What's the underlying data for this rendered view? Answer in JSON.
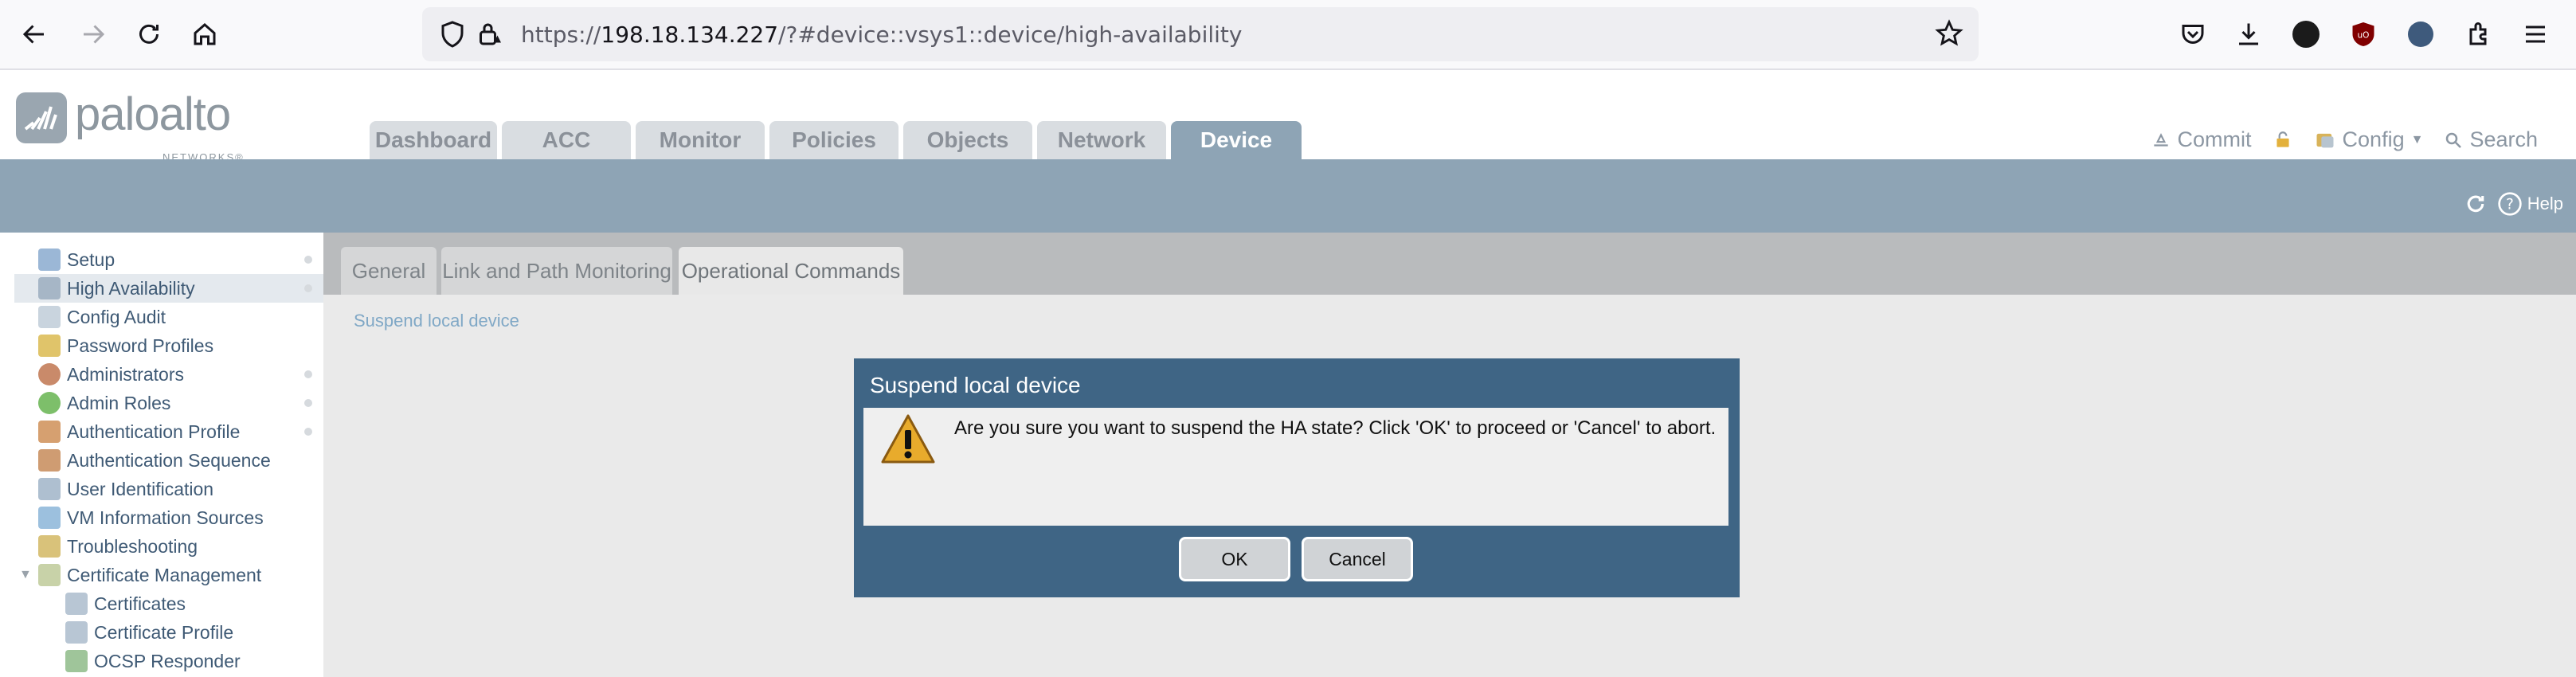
{
  "browser": {
    "url_prefix": "https://",
    "url_host": "198.18.134.227",
    "url_path": "/?#device::vsys1::device/high-availability"
  },
  "logo": {
    "name": "paloalto",
    "sub": "NETWORKS®"
  },
  "main_tabs": [
    {
      "label": "Dashboard"
    },
    {
      "label": "ACC"
    },
    {
      "label": "Monitor"
    },
    {
      "label": "Policies"
    },
    {
      "label": "Objects"
    },
    {
      "label": "Network"
    },
    {
      "label": "Device"
    }
  ],
  "header_actions": {
    "commit": "Commit",
    "config": "Config",
    "search": "Search",
    "help": "Help"
  },
  "sidebar": {
    "items": [
      {
        "label": "Setup"
      },
      {
        "label": "High Availability"
      },
      {
        "label": "Config Audit"
      },
      {
        "label": "Password Profiles"
      },
      {
        "label": "Administrators"
      },
      {
        "label": "Admin Roles"
      },
      {
        "label": "Authentication Profile"
      },
      {
        "label": "Authentication Sequence"
      },
      {
        "label": "User Identification"
      },
      {
        "label": "VM Information Sources"
      },
      {
        "label": "Troubleshooting"
      },
      {
        "label": "Certificate Management"
      },
      {
        "label": "Certificates"
      },
      {
        "label": "Certificate Profile"
      },
      {
        "label": "OCSP Responder"
      }
    ]
  },
  "sub_tabs": [
    {
      "label": "General"
    },
    {
      "label": "Link and Path Monitoring"
    },
    {
      "label": "Operational Commands"
    }
  ],
  "content": {
    "link": "Suspend local device"
  },
  "dialog": {
    "title": "Suspend local device",
    "message": "Are you sure you want to suspend the HA state? Click 'OK' to proceed or 'Cancel' to abort.",
    "ok": "OK",
    "cancel": "Cancel"
  },
  "colors": {
    "accent": "#8ea4b5",
    "dialog": "#3f6585"
  }
}
